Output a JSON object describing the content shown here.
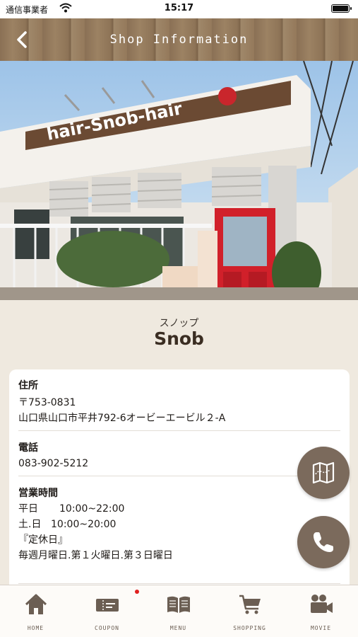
{
  "status_bar": {
    "carrier": "通信事業者",
    "time": "15:17"
  },
  "header": {
    "title": "Shop Information",
    "back_icon": "chevron-left-icon"
  },
  "hero": {
    "sign_text": "hair-Snob-hair"
  },
  "shop": {
    "kana": "スノップ",
    "name": "Snob"
  },
  "info": {
    "address": {
      "label": "住所",
      "postal": "〒753-0831",
      "line": "山口県山口市平井792-6オービーエービル２-A"
    },
    "phone": {
      "label": "電話",
      "number": "083-902-5212"
    },
    "hours": {
      "label": "営業時間",
      "rows": [
        {
          "day": "平日",
          "time": "10:00~22:00"
        },
        {
          "day": "土.日",
          "time": "10:00~20:00"
        }
      ],
      "closed_label": "『定休日』",
      "closed_days": "毎週月曜日.第１火曜日.第３日曜日"
    }
  },
  "fabs": {
    "map_icon": "map-icon",
    "phone_icon": "phone-icon"
  },
  "tabs": [
    {
      "label": "HOME",
      "icon": "home-icon"
    },
    {
      "label": "COUPON",
      "icon": "coupon-icon",
      "badge": true
    },
    {
      "label": "MENU",
      "icon": "menu-book-icon"
    },
    {
      "label": "SHOPPING",
      "icon": "cart-icon"
    },
    {
      "label": "MOVIE",
      "icon": "video-camera-icon"
    }
  ],
  "colors": {
    "accent": "#7b6a5c",
    "background": "#efe9df",
    "badge": "#e02020"
  }
}
